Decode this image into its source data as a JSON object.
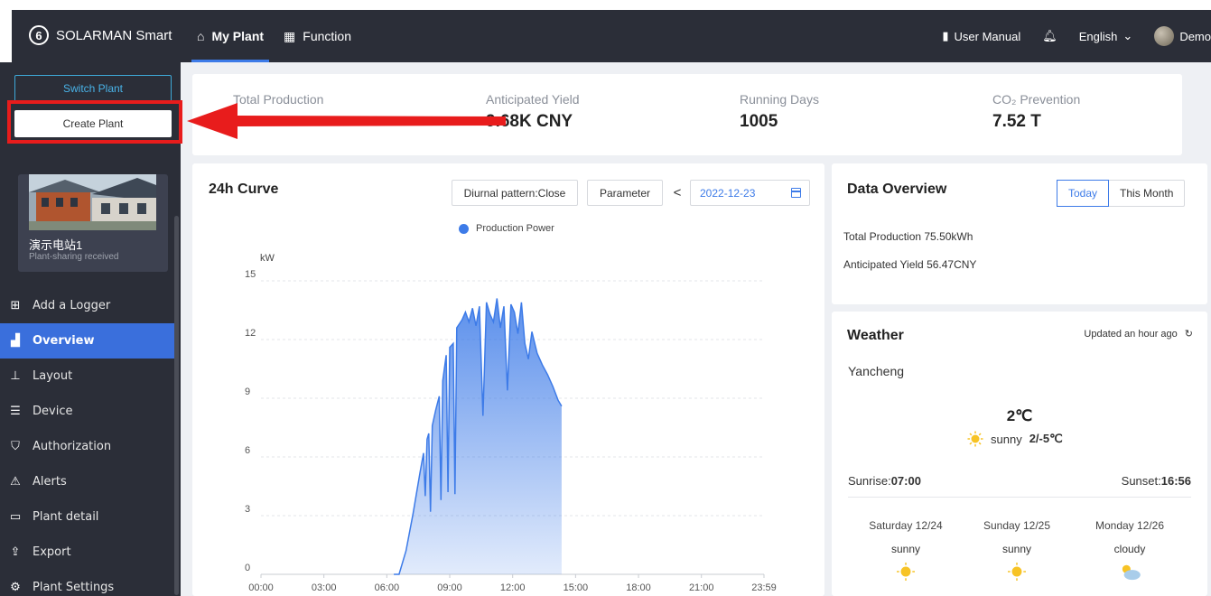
{
  "app": {
    "brand": "SOLARMAN Smart"
  },
  "nav": [
    {
      "label": "My Plant",
      "icon": "home-icon",
      "active": true
    },
    {
      "label": "Function",
      "icon": "grid-icon",
      "active": false
    }
  ],
  "topbar_right": {
    "manual": "User Manual",
    "language": "English",
    "user": "Demo"
  },
  "sidebar": {
    "switch_plant": "Switch Plant",
    "create_plant": "Create Plant",
    "plant": {
      "name": "演示电站1",
      "status": "Plant-sharing received"
    },
    "menu": [
      {
        "label": "Add a Logger",
        "icon": "plus-square-icon",
        "active": false
      },
      {
        "label": "Overview",
        "icon": "chart-icon",
        "active": true
      },
      {
        "label": "Layout",
        "icon": "layout-icon",
        "active": false
      },
      {
        "label": "Device",
        "icon": "device-icon",
        "active": false
      },
      {
        "label": "Authorization",
        "icon": "shield-icon",
        "active": false
      },
      {
        "label": "Alerts",
        "icon": "bell-alert-icon",
        "active": false
      },
      {
        "label": "Plant detail",
        "icon": "folder-icon",
        "active": false
      },
      {
        "label": "Export",
        "icon": "export-icon",
        "active": false
      },
      {
        "label": "Plant Settings",
        "icon": "gear-icon",
        "active": false
      }
    ]
  },
  "stats": [
    {
      "label": "Total Production",
      "value": ""
    },
    {
      "label": "Anticipated Yield",
      "value": "9.68K CNY"
    },
    {
      "label": "Running Days",
      "value": "1005"
    },
    {
      "label": "CO₂ Prevention",
      "value": "7.52 T"
    }
  ],
  "curve": {
    "title": "24h Curve",
    "diurnal": "Diurnal pattern:Close",
    "parameter": "Parameter",
    "prev": "<",
    "date": "2022-12-23",
    "legend": "Production Power",
    "unit": "kW"
  },
  "chart_data": {
    "type": "area",
    "series": [
      {
        "name": "Production Power",
        "color": "#3d7be8"
      }
    ],
    "ylabel": "kW",
    "ylim": [
      0,
      15
    ],
    "yticks": [
      "0",
      "3",
      "6",
      "9",
      "12",
      "15"
    ],
    "xticks": [
      "00:00",
      "03:00",
      "06:00",
      "09:00",
      "12:00",
      "15:00",
      "18:00",
      "21:00",
      "23:59"
    ],
    "grid": true,
    "points": [
      [
        "06:20",
        0
      ],
      [
        "06:35",
        0
      ],
      [
        "06:55",
        1.2
      ],
      [
        "07:15",
        3.1
      ],
      [
        "07:35",
        5.2
      ],
      [
        "07:45",
        6.2
      ],
      [
        "07:50",
        4.0
      ],
      [
        "07:55",
        6.9
      ],
      [
        "08:00",
        7.2
      ],
      [
        "08:05",
        3.2
      ],
      [
        "08:10",
        7.6
      ],
      [
        "08:20",
        8.4
      ],
      [
        "08:30",
        9.1
      ],
      [
        "08:35",
        3.8
      ],
      [
        "08:40",
        9.9
      ],
      [
        "08:50",
        11.2
      ],
      [
        "08:55",
        4.2
      ],
      [
        "09:00",
        11.6
      ],
      [
        "09:10",
        11.8
      ],
      [
        "09:15",
        4.1
      ],
      [
        "09:20",
        12.6
      ],
      [
        "09:35",
        13.0
      ],
      [
        "09:45",
        13.4
      ],
      [
        "09:55",
        12.9
      ],
      [
        "10:05",
        13.6
      ],
      [
        "10:15",
        12.7
      ],
      [
        "10:25",
        13.7
      ],
      [
        "10:35",
        8.1
      ],
      [
        "10:45",
        13.9
      ],
      [
        "10:55",
        13.3
      ],
      [
        "11:05",
        12.9
      ],
      [
        "11:15",
        14.1
      ],
      [
        "11:25",
        12.6
      ],
      [
        "11:35",
        13.7
      ],
      [
        "11:45",
        9.4
      ],
      [
        "11:55",
        13.8
      ],
      [
        "12:05",
        13.4
      ],
      [
        "12:15",
        12.3
      ],
      [
        "12:25",
        13.9
      ],
      [
        "12:35",
        11.8
      ],
      [
        "12:45",
        11.0
      ],
      [
        "12:55",
        12.4
      ],
      [
        "13:10",
        11.3
      ],
      [
        "13:25",
        10.7
      ],
      [
        "13:40",
        10.2
      ],
      [
        "13:55",
        9.6
      ],
      [
        "14:10",
        8.9
      ],
      [
        "14:20",
        8.6
      ]
    ]
  },
  "overview": {
    "title": "Data Overview",
    "tab_today": "Today",
    "tab_month": "This Month",
    "total_production": "Total Production 75.50kWh",
    "anticipated_yield": "Anticipated Yield 56.47CNY"
  },
  "weather": {
    "title": "Weather",
    "updated": "Updated an hour ago",
    "city": "Yancheng",
    "temp": "2℃",
    "condition": "sunny",
    "range": "2/-5℃",
    "sunrise_label": "Sunrise:",
    "sunrise": "07:00",
    "sunset_label": "Sunset:",
    "sunset": "16:56",
    "forecast": [
      {
        "day": "Saturday 12/24",
        "cond": "sunny",
        "icon": "sun-icon"
      },
      {
        "day": "Sunday 12/25",
        "cond": "sunny",
        "icon": "sun-icon"
      },
      {
        "day": "Monday 12/26",
        "cond": "cloudy",
        "icon": "cloud-icon"
      }
    ]
  },
  "colors": {
    "accent": "#3d7be8",
    "dark": "#2b2e38",
    "annotation_red": "#e81c1c"
  }
}
